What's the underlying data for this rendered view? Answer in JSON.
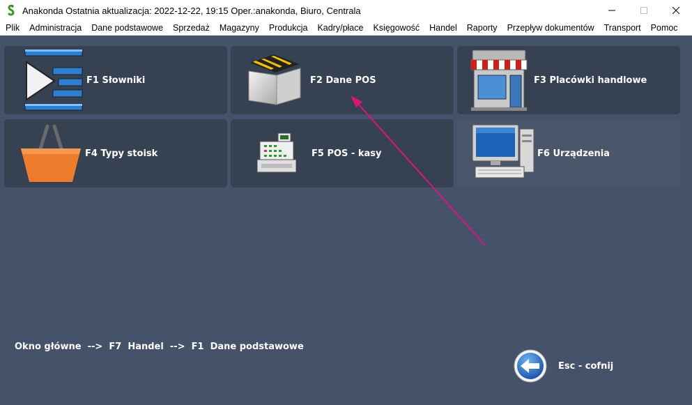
{
  "window": {
    "title": "Anakonda Ostatnia aktualizacja: 2022-12-22, 19:15 Oper.:anakonda, Biuro, Centrala"
  },
  "menu": [
    {
      "label": "Plik"
    },
    {
      "label": "Administracja"
    },
    {
      "label": "Dane podstawowe"
    },
    {
      "label": "Sprzedaż"
    },
    {
      "label": "Magazyny"
    },
    {
      "label": "Produkcja"
    },
    {
      "label": "Kadry/płace"
    },
    {
      "label": "Księgowość"
    },
    {
      "label": "Handel"
    },
    {
      "label": "Raporty"
    },
    {
      "label": "Przepływ dokumentów"
    },
    {
      "label": "Transport"
    },
    {
      "label": "Pomoc"
    }
  ],
  "tiles": [
    {
      "label": "F1  Słowniki",
      "icon": "list-play-icon"
    },
    {
      "label": "F2  Dane POS",
      "icon": "folder-icon"
    },
    {
      "label": "F3  Placówki handlowe",
      "icon": "store-icon"
    },
    {
      "label": "F4  Typy stoisk",
      "icon": "basket-icon"
    },
    {
      "label": "F5  POS - kasy",
      "icon": "cash-register-icon"
    },
    {
      "label": "F6  Urządzenia",
      "icon": "computer-icon"
    }
  ],
  "breadcrumb": "Okno główne  -->  F7  Handel  -->  F1  Dane podstawowe",
  "back": {
    "label": "Esc - cofnij"
  },
  "colors": {
    "background": "#45526a",
    "tile": "#364152",
    "tile_highlight": "#4a5669",
    "annotation_arrow": "#e0137a"
  }
}
